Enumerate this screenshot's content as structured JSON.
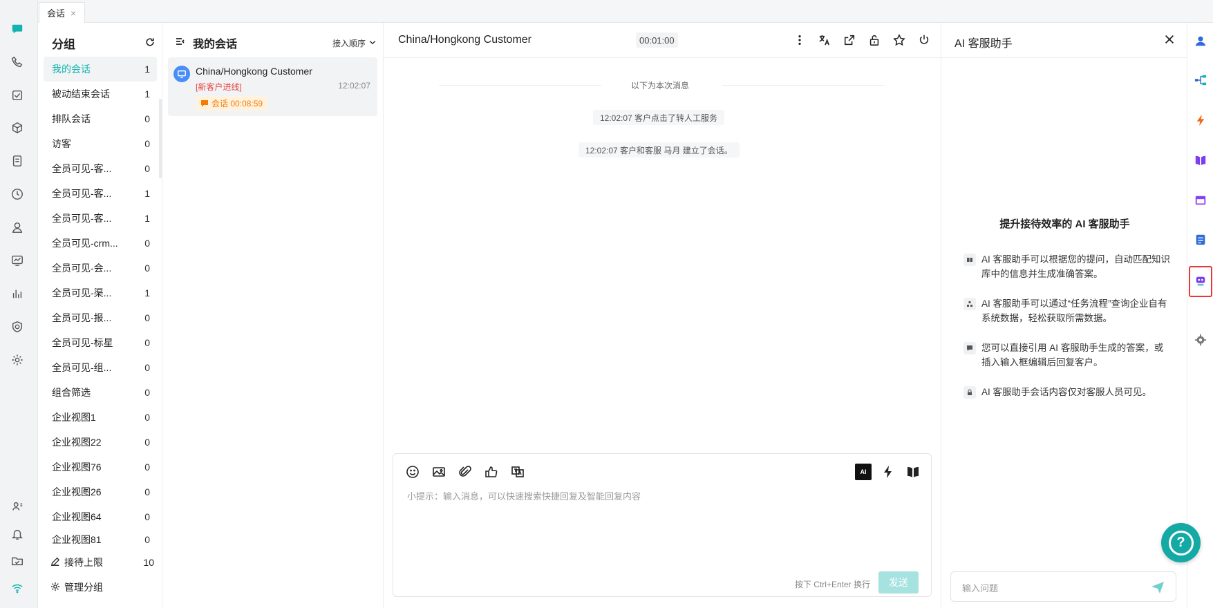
{
  "tabs": [
    {
      "label": "会话",
      "close": "×"
    }
  ],
  "groups": {
    "title": "分组",
    "items": [
      {
        "label": "我的会话",
        "count": "1"
      },
      {
        "label": "被动结束会话",
        "count": "1"
      },
      {
        "label": "排队会话",
        "count": "0"
      },
      {
        "label": "访客",
        "count": "0"
      },
      {
        "label": "全员可见-客...",
        "count": "0"
      },
      {
        "label": "全员可见-客...",
        "count": "1"
      },
      {
        "label": "全员可见-客...",
        "count": "1"
      },
      {
        "label": "全员可见-crm...",
        "count": "0"
      },
      {
        "label": "全员可见-会...",
        "count": "0"
      },
      {
        "label": "全员可见-渠...",
        "count": "1"
      },
      {
        "label": "全员可见-报...",
        "count": "0"
      },
      {
        "label": "全员可见-标星",
        "count": "0"
      },
      {
        "label": "全员可见-组...",
        "count": "0"
      },
      {
        "label": "组合筛选",
        "count": "0"
      },
      {
        "label": "企业视图1",
        "count": "0"
      },
      {
        "label": "企业视图22",
        "count": "0"
      },
      {
        "label": "企业视图76",
        "count": "0"
      },
      {
        "label": "企业视图26",
        "count": "0"
      },
      {
        "label": "企业视图64",
        "count": "0"
      },
      {
        "label": "企业视图81",
        "count": "0"
      }
    ],
    "limit_label": "接待上限",
    "limit_value": "10",
    "manage_label": "管理分组"
  },
  "conversations": {
    "title": "我的会话",
    "sort_label": "接入顺序",
    "items": [
      {
        "name": "China/Hongkong Customer",
        "tag": "[新客户进线]",
        "time": "12:02:07",
        "badge": "会话 00:08:59"
      }
    ]
  },
  "chat": {
    "title": "China/Hongkong Customer",
    "timer": "00:01:00",
    "divider": "以下为本次消息",
    "system_messages": [
      "12:02:07 客户点击了转人工服务",
      "12:02:07 客户和客服 马月 建立了会话。"
    ],
    "ai_chip": "AI",
    "placeholder": "小提示：输入消息，可以快速搜索快捷回复及智能回复内容",
    "hint": "按下 Ctrl+Enter 换行",
    "send": "发送"
  },
  "ai_panel": {
    "title": "AI 客服助手",
    "hero": "提升接待效率的 AI 客服助手",
    "features": [
      {
        "icon": "book-icon",
        "text": "AI 客服助手可以根据您的提问，自动匹配知识库中的信息并生成准确答案。"
      },
      {
        "icon": "flow-icon",
        "text": "AI 客服助手可以通过“任务流程”查询企业自有系统数据，轻松获取所需数据。"
      },
      {
        "icon": "message-icon",
        "text": "您可以直接引用 AI 客服助手生成的答案，或插入输入框编辑后回复客户。"
      },
      {
        "icon": "lock-icon",
        "text": "AI 客服助手会话内容仅对客服人员可见。"
      }
    ],
    "input_placeholder": "输入问题"
  },
  "colors": {
    "accent": "#13b4b0",
    "send_disabled": "#a6e2e0",
    "new_tag": "#e8413c",
    "badge": "#f57c00",
    "highlight": "#e53935"
  }
}
